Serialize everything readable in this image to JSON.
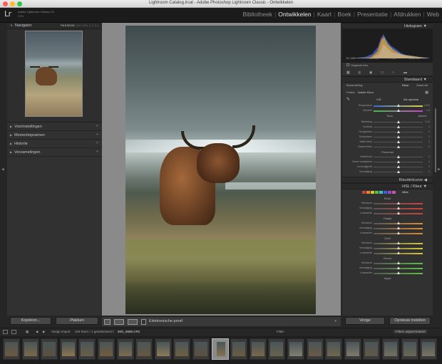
{
  "window": {
    "title": "Lightroom Catalog.lrcat - Adobe Photoshop Lightroom Classic - Ontwikkelen"
  },
  "identity": {
    "logo": "Lr",
    "app_name": "Adobe Lightroom Classic CC",
    "sub": "SYD"
  },
  "modules": [
    "Bibliotheek",
    "Ontwikkelen",
    "Kaart",
    "Boek",
    "Presentatie",
    "Afdrukken",
    "Web"
  ],
  "active_module": "Ontwikkelen",
  "left": {
    "navigator": {
      "label": "Navigator",
      "options": [
        "PASSEND",
        "VULLEN",
        "1:1",
        "3:1"
      ]
    },
    "panels": [
      "Voorinstellingen",
      "Momentopnamen",
      "Historie",
      "Verzamelingen"
    ],
    "copy": "Kopiëren...",
    "paste": "Plakken"
  },
  "toolbar": {
    "soft_proof": "Elektronische proef"
  },
  "right": {
    "histogram": {
      "label": "Histogram",
      "iso": "ISO 500",
      "focal": "560 mm",
      "aperture": "f / 5,6",
      "shutter": "1/640 sec",
      "original": "Originele foto"
    },
    "standard": "Standaard",
    "treatment": {
      "label": "Behandeling:",
      "color": "Kleur",
      "bw": "Zwart-wit"
    },
    "profile": {
      "label": "Profiel:",
      "value": "Adobe Kleur"
    },
    "wb": {
      "label": "WB:",
      "value": "Als opname"
    },
    "sliders_wb": [
      {
        "label": "Temperatuur",
        "value": "4.900"
      },
      {
        "label": "Kleurtint",
        "value": "+ 15"
      }
    ],
    "tone": {
      "label": "Toon",
      "auto": "Autom."
    },
    "sliders_tone": [
      {
        "label": "Belichting",
        "value": "0,00"
      },
      {
        "label": "Contrast",
        "value": "0"
      },
      {
        "label": "Hooglichten",
        "value": "0"
      },
      {
        "label": "Schaduwen",
        "value": "0"
      },
      {
        "label": "Witte tinten",
        "value": "0"
      },
      {
        "label": "Zwarte tinten",
        "value": "0"
      }
    ],
    "presence": {
      "label": "Presentie"
    },
    "sliders_presence": [
      {
        "label": "Helderheid",
        "value": "0"
      },
      {
        "label": "Nevel verwijderen",
        "value": "0"
      },
      {
        "label": "Levendigheid",
        "value": "0"
      },
      {
        "label": "Verzadiging",
        "value": "0"
      }
    ],
    "tone_curve": "Kleurtintcurve",
    "hsl": {
      "label": "HSL / Kleur",
      "all": "Alles"
    },
    "hsl_groups": [
      {
        "name": "Rood",
        "rows": [
          "Kleurtoon",
          "Verzadiging",
          "Luminantie"
        ]
      },
      {
        "name": "Oranje",
        "rows": [
          "Kleurtoon",
          "Verzadiging",
          "Luminantie"
        ]
      },
      {
        "name": "Geel",
        "rows": [
          "Kleurtoon",
          "Verzadiging",
          "Luminantie"
        ]
      },
      {
        "name": "Groen",
        "rows": [
          "Kleurtoon",
          "Verzadiging",
          "Luminantie"
        ]
      },
      {
        "name": "Aqua",
        "rows": []
      }
    ],
    "previous": "Vorige",
    "reset": "Opnieuw instellen"
  },
  "filmbar": {
    "source": "Vorige import",
    "count": "344 foto's / 1 geselecteerd /",
    "file": "IMG_8696.CR2",
    "filter_label": "Filter:",
    "filter_value": "Filters uitgeschakeld"
  },
  "colors": {
    "accent": "#e8e8e8",
    "panel": "#313131",
    "background": "#262626"
  }
}
